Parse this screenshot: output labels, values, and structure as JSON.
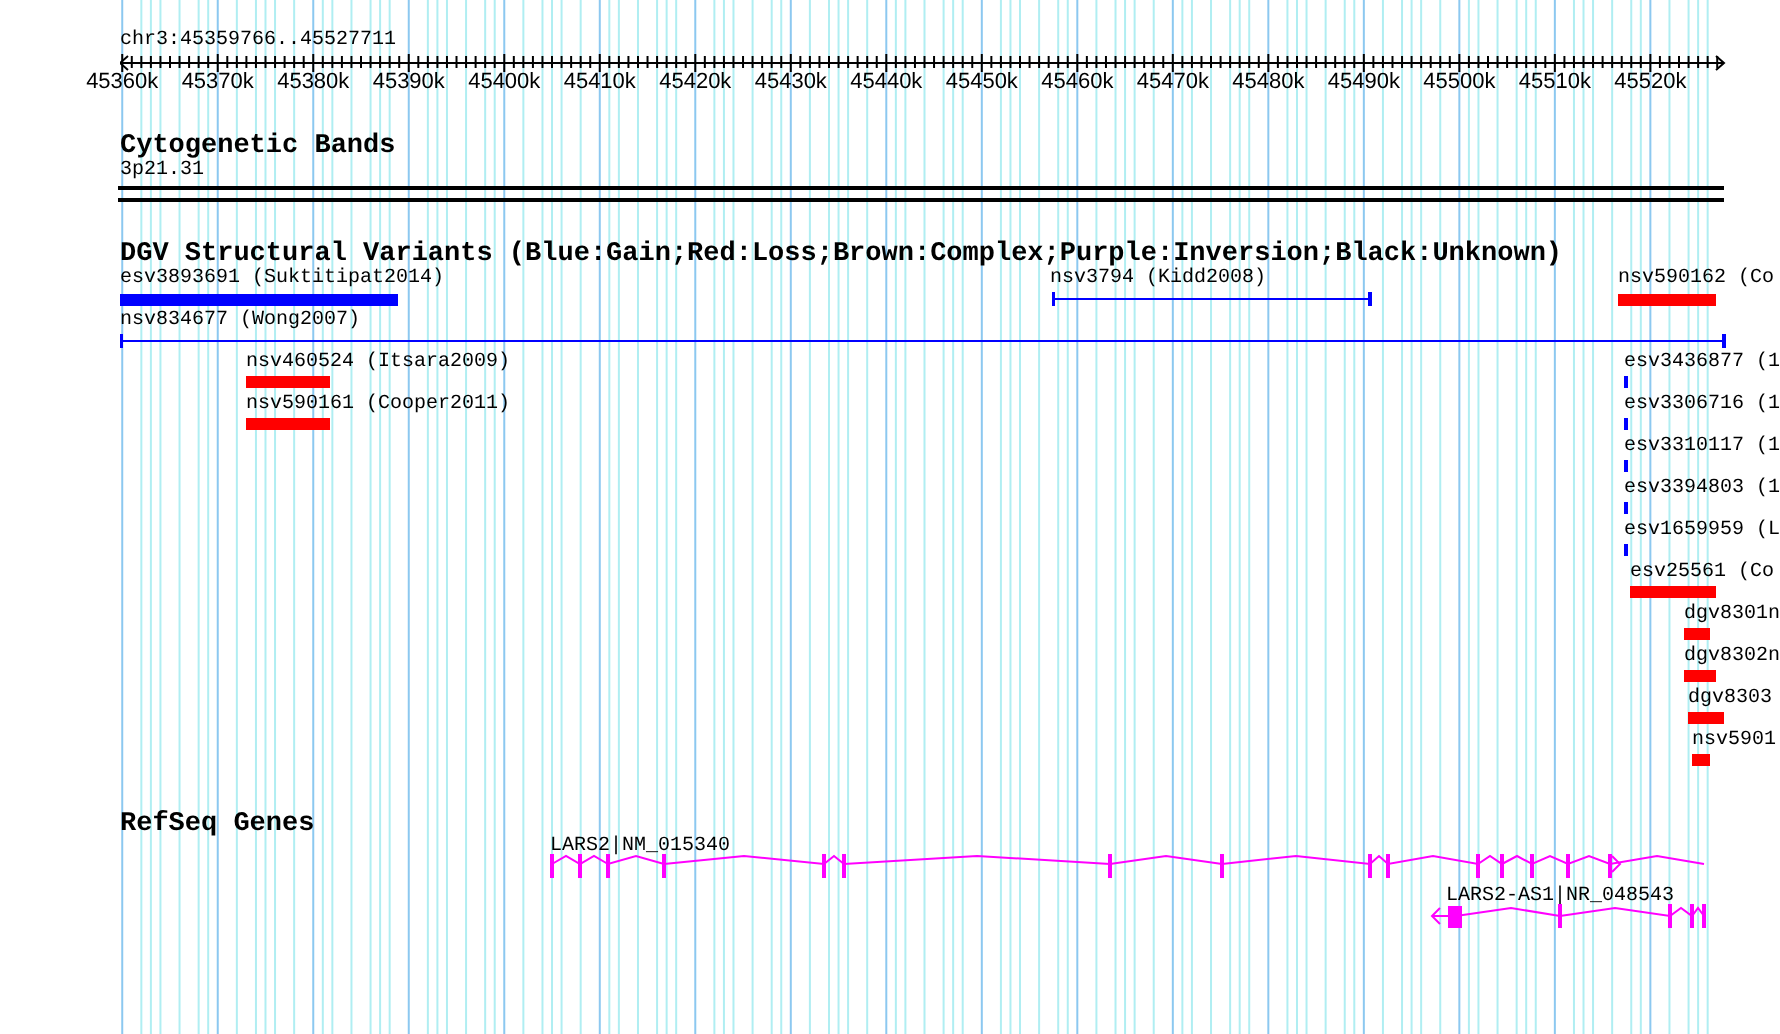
{
  "locus": "chr3:45359766..45527711",
  "ruler": {
    "labels": [
      "45360k",
      "45370k",
      "45380k",
      "45390k",
      "45400k",
      "45410k",
      "45420k",
      "45430k",
      "45440k",
      "45450k",
      "45460k",
      "45470k",
      "45480k",
      "45490k",
      "45500k",
      "45510k",
      "45520k"
    ]
  },
  "tracks": [
    {
      "kind": "bands",
      "title": "Cytogenetic Bands",
      "band": "3p21.31"
    },
    {
      "kind": "variants",
      "title": "DGV Structural Variants (Blue:Gain;Red:Loss;Brown:Complex;Purple:Inversion;Black:Unknown)",
      "features": [
        {
          "label": "esv3893691 (Suktitipat2014)",
          "color": "#0000ff",
          "kind": "bar"
        },
        {
          "label": "nsv3794 (Kidd2008)",
          "color": "#0000ff",
          "kind": "span"
        },
        {
          "label": "nsv590162 (Co",
          "color": "#ff0000",
          "kind": "bar"
        },
        {
          "label": "nsv834677 (Wong2007)",
          "color": "#0000ff",
          "kind": "span"
        },
        {
          "label": "nsv460524 (Itsara2009)",
          "color": "#ff0000",
          "kind": "bar"
        },
        {
          "label": "nsv590161 (Cooper2011)",
          "color": "#ff0000",
          "kind": "bar"
        },
        {
          "label": "esv3436877 (1",
          "color": "#0000ff",
          "kind": "bar"
        },
        {
          "label": "esv3306716 (1",
          "color": "#0000ff",
          "kind": "bar"
        },
        {
          "label": "esv3310117 (1",
          "color": "#0000ff",
          "kind": "bar"
        },
        {
          "label": "esv3394803 (1",
          "color": "#0000ff",
          "kind": "bar"
        },
        {
          "label": "esv1659959 (L",
          "color": "#0000ff",
          "kind": "bar"
        },
        {
          "label": "esv25561 (Co",
          "color": "#ff0000",
          "kind": "bar"
        },
        {
          "label": "dgv8301n",
          "color": "#ff0000",
          "kind": "bar"
        },
        {
          "label": "dgv8302n",
          "color": "#ff0000",
          "kind": "bar"
        },
        {
          "label": "dgv8303",
          "color": "#ff0000",
          "kind": "bar"
        },
        {
          "label": "nsv5901",
          "color": "#ff0000",
          "kind": "bar"
        }
      ]
    },
    {
      "kind": "genes",
      "title": "RefSeq Genes",
      "genes": [
        {
          "label": "LARS2|NM_015340",
          "kind": "forward"
        },
        {
          "label": "LARS2-AS1|NR_048543",
          "kind": "reverse"
        }
      ]
    }
  ]
}
